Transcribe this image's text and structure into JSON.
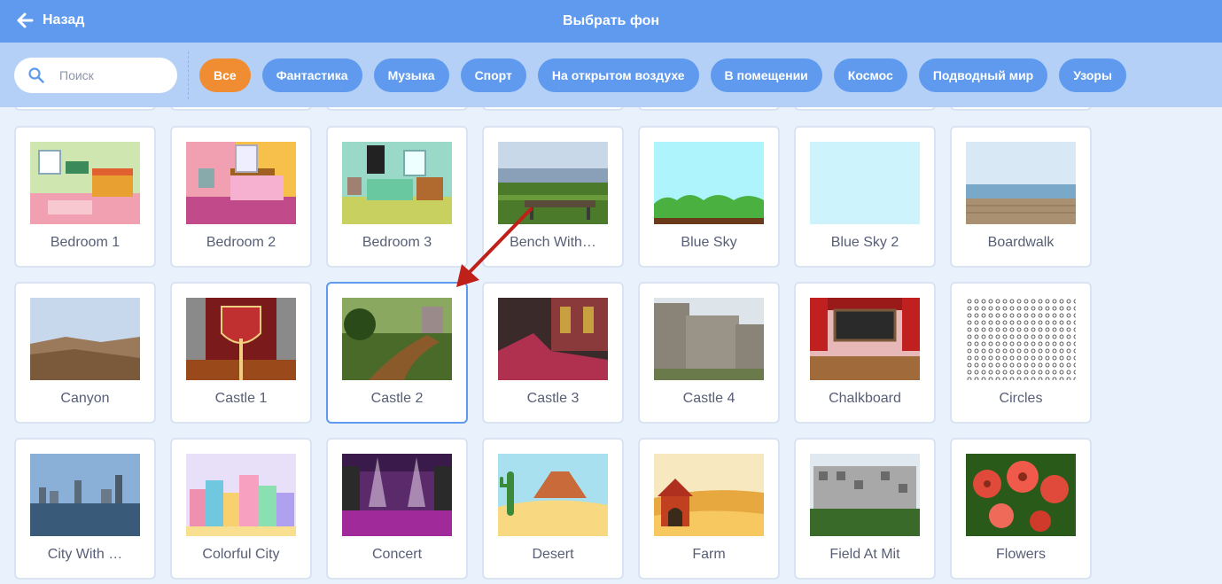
{
  "header": {
    "back_label": "Назад",
    "title": "Выбрать фон"
  },
  "search": {
    "placeholder": "Поиск"
  },
  "tags": [
    {
      "label": "Все",
      "active": true
    },
    {
      "label": "Фантастика"
    },
    {
      "label": "Музыка"
    },
    {
      "label": "Спорт"
    },
    {
      "label": "На открытом воздухе"
    },
    {
      "label": "В помещении"
    },
    {
      "label": "Космос"
    },
    {
      "label": "Подводный мир"
    },
    {
      "label": "Узоры"
    }
  ],
  "backdrops": [
    {
      "name": "Bedroom 1",
      "icon": "bedroom-1-thumbnail"
    },
    {
      "name": "Bedroom 2",
      "icon": "bedroom-2-thumbnail"
    },
    {
      "name": "Bedroom 3",
      "icon": "bedroom-3-thumbnail"
    },
    {
      "name": "Bench With…",
      "icon": "bench-with-view-thumbnail"
    },
    {
      "name": "Blue Sky",
      "icon": "blue-sky-thumbnail"
    },
    {
      "name": "Blue Sky 2",
      "icon": "blue-sky-2-thumbnail"
    },
    {
      "name": "Boardwalk",
      "icon": "boardwalk-thumbnail"
    },
    {
      "name": "Canyon",
      "icon": "canyon-thumbnail"
    },
    {
      "name": "Castle 1",
      "icon": "castle-1-thumbnail"
    },
    {
      "name": "Castle 2",
      "icon": "castle-2-thumbnail",
      "selected": true
    },
    {
      "name": "Castle 3",
      "icon": "castle-3-thumbnail"
    },
    {
      "name": "Castle 4",
      "icon": "castle-4-thumbnail"
    },
    {
      "name": "Chalkboard",
      "icon": "chalkboard-thumbnail"
    },
    {
      "name": "Circles",
      "icon": "circles-thumbnail"
    },
    {
      "name": "City With …",
      "icon": "city-with-water-thumbnail"
    },
    {
      "name": "Colorful City",
      "icon": "colorful-city-thumbnail"
    },
    {
      "name": "Concert",
      "icon": "concert-thumbnail"
    },
    {
      "name": "Desert",
      "icon": "desert-thumbnail"
    },
    {
      "name": "Farm",
      "icon": "farm-thumbnail"
    },
    {
      "name": "Field At Mit",
      "icon": "field-at-mit-thumbnail"
    },
    {
      "name": "Flowers",
      "icon": "flowers-thumbnail"
    }
  ],
  "colors": {
    "header": "#5f9aef",
    "filter_bar": "#b4d0f7",
    "active_tag": "#f08d32",
    "tag": "#5f9aef",
    "annotation_arrow": "#c0201a"
  },
  "icons": {
    "back": "arrow-left-icon",
    "search": "magnifier-icon",
    "annotation": "red-arrow-icon"
  }
}
